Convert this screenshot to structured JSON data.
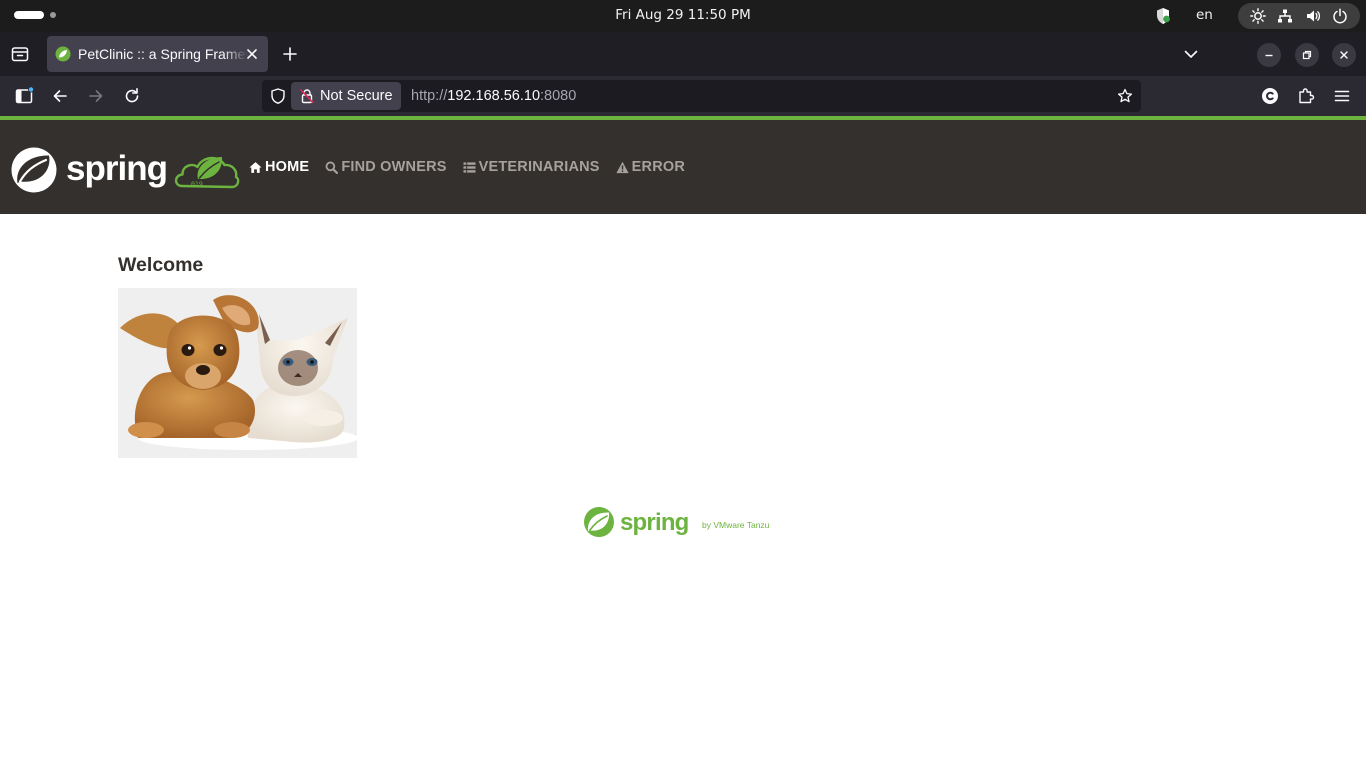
{
  "system_bar": {
    "clock": "Fri Aug 29  11:50 PM",
    "language": "en"
  },
  "browser": {
    "tab": {
      "title": "PetClinic :: a Spring Framework demonstration"
    },
    "url_bar": {
      "security_label": "Not Secure",
      "url_scheme": "http://",
      "url_host": "192.168.56.10",
      "url_port": ":8080"
    }
  },
  "app": {
    "brand_text": "spring",
    "brand_badge_text": "019",
    "nav": [
      {
        "label": "Home",
        "icon": "home-icon",
        "active": true
      },
      {
        "label": "Find owners",
        "icon": "search-icon",
        "active": false
      },
      {
        "label": "Veterinarians",
        "icon": "list-icon",
        "active": false
      },
      {
        "label": "Error",
        "icon": "warning-icon",
        "active": false
      }
    ],
    "heading": "Welcome",
    "footer_logo_text": "spring",
    "footer_logo_suffix": "by VMware Tanzu"
  },
  "colors": {
    "spring_green": "#6db33f",
    "nav_background": "#34302d",
    "nav_inactive": "#a7a19c",
    "topbar": "#1c1c1c",
    "tabstrip": "#1f1e25",
    "toolbar": "#2b2a33"
  }
}
